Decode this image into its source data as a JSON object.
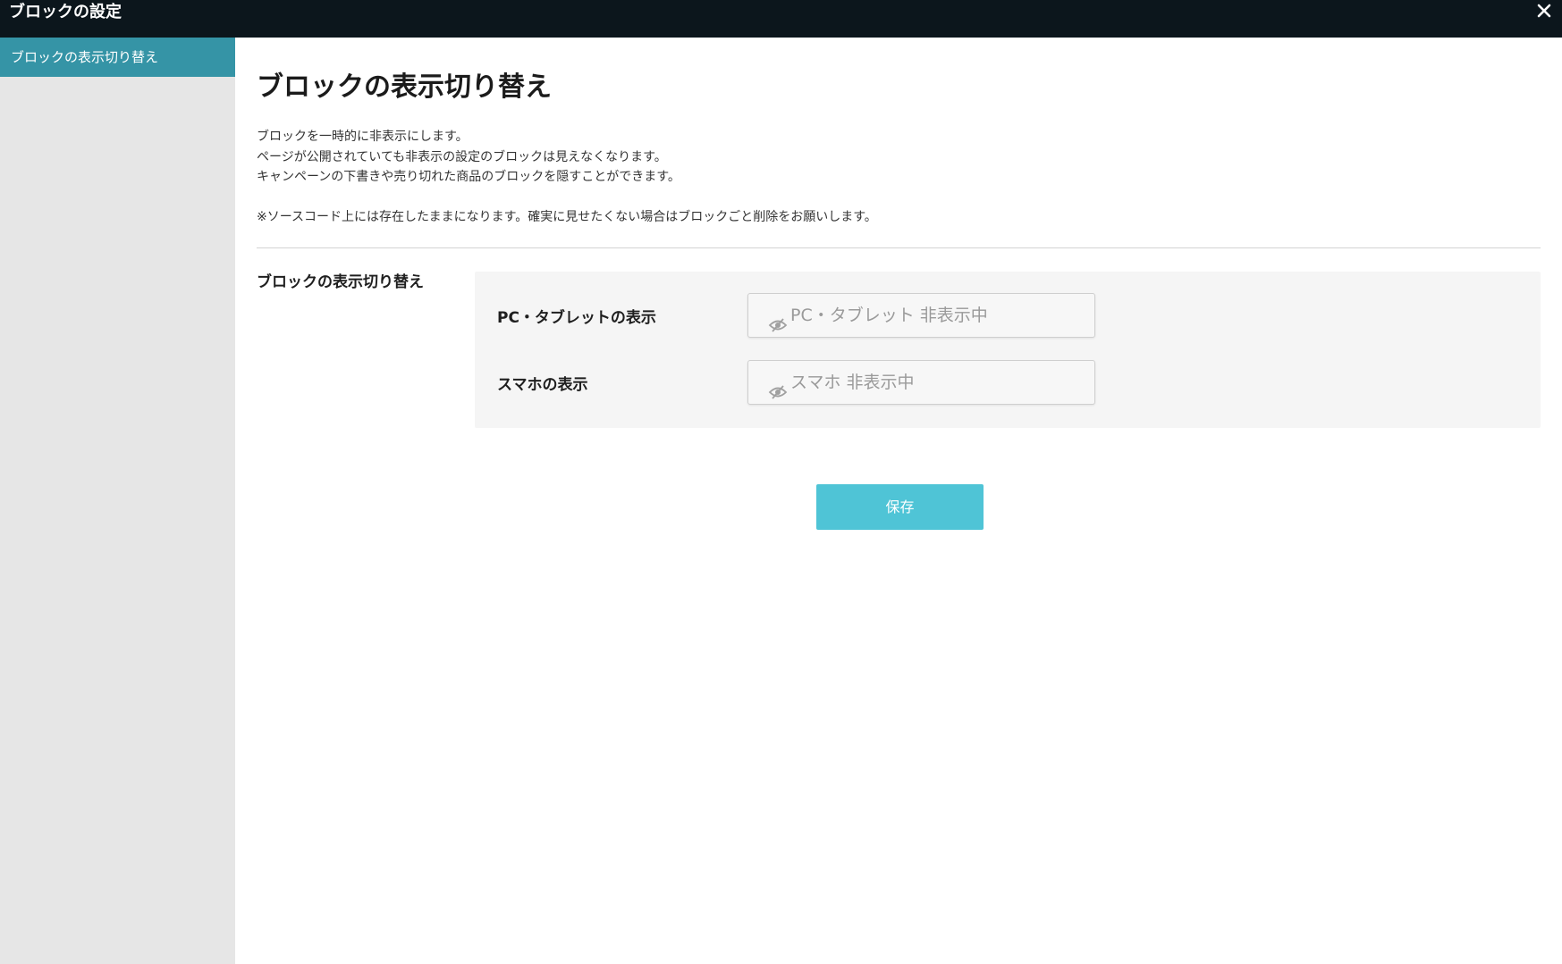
{
  "window": {
    "title": "ブロックの設定"
  },
  "sidebar": {
    "items": [
      {
        "label": "ブロックの表示切り替え",
        "active": true
      }
    ]
  },
  "main": {
    "title": "ブロックの表示切り替え",
    "description": [
      "ブロックを一時的に非表示にします。",
      "ページが公開されていても非表示の設定のブロックは見えなくなります。",
      "キャンペーンの下書きや売り切れた商品のブロックを隠すことができます。"
    ],
    "note": "※ソースコード上には存在したままになります。確実に見せたくない場合はブロックごと削除をお願いします。",
    "section": {
      "label": "ブロックの表示切り替え",
      "rows": [
        {
          "label": "PC・タブレットの表示",
          "button_text": "PC・タブレット 非表示中",
          "icon": "eye-slash-icon"
        },
        {
          "label": "スマホの表示",
          "button_text": "スマホ 非表示中",
          "icon": "eye-slash-icon"
        }
      ]
    },
    "save_label": "保存"
  },
  "colors": {
    "titlebar": "#0c161c",
    "sidebar_bg": "#e6e6e6",
    "sidebar_active": "#3594a6",
    "save_button": "#4fc4d6",
    "panel_bg": "#f5f5f5"
  }
}
